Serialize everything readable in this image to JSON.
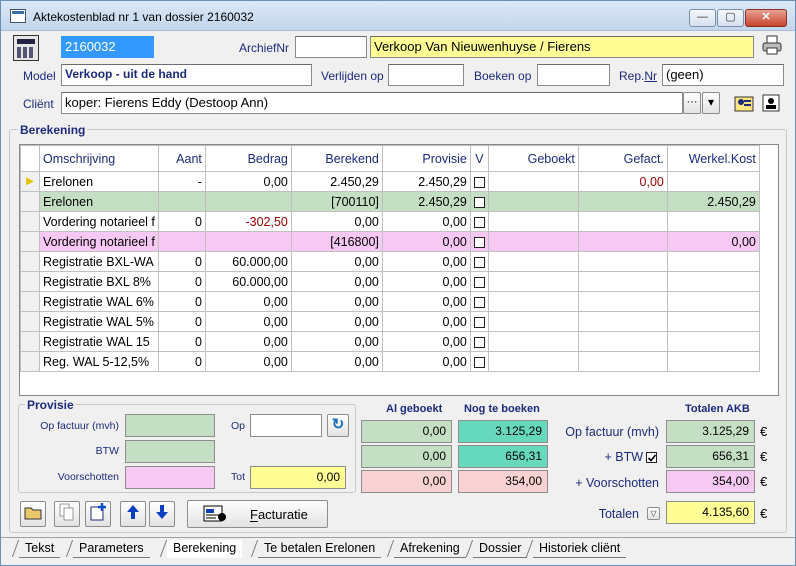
{
  "window": {
    "title": "Aktekostenblad nr 1 van dossier 2160032",
    "minimize": "—",
    "maximize": "▢",
    "close": "✕"
  },
  "header": {
    "dossier_no": "2160032",
    "archief_label": "ArchiefNr",
    "archief_value": "",
    "dossier_title": "Verkoop Van Nieuwenhuyse / Fierens",
    "model_label": "Model",
    "model_value": "Verkoop - uit de hand",
    "verlijden_label": "Verlijden op",
    "verlijden_value": "",
    "boeken_label": "Boeken op",
    "boeken_value": "",
    "repnr_label": "Rep.",
    "repnr_label_u": "Nr",
    "repnr_value": "(geen)",
    "client_label": "Cliënt",
    "client_value": "koper: Fierens Eddy (Destoop Ann)",
    "client_more": "···",
    "client_dropdown": "▾"
  },
  "berekening": {
    "title": "Berekening",
    "columns": [
      "Omschrijving",
      "Aant",
      "Bedrag",
      "Berekend",
      "Provisie",
      "V",
      "Geboekt",
      "Gefact.",
      "Werkel.Kost"
    ],
    "rows": [
      {
        "type": "normal",
        "current": "▶",
        "omschrijving": "Erelonen",
        "aant": "-",
        "bedrag": "0,00",
        "berekend": "2.450,29",
        "provisie": "2.450,29",
        "geboekt": "",
        "gefact": "0,00",
        "werkel": ""
      },
      {
        "type": "green",
        "current": "",
        "omschrijving": "Erelonen",
        "aant": "",
        "bedrag": "",
        "berekend": "[700110]",
        "provisie": "2.450,29",
        "geboekt": "",
        "gefact": "",
        "werkel": "2.450,29"
      },
      {
        "type": "normal",
        "current": "",
        "omschrijving": "Vordering notarieel f",
        "aant": "0",
        "bedrag": "-302,50",
        "berekend": "0,00",
        "provisie": "0,00",
        "geboekt": "",
        "gefact": "",
        "werkel": ""
      },
      {
        "type": "pink",
        "current": "",
        "omschrijving": "Vordering notarieel f",
        "aant": "",
        "bedrag": "",
        "berekend": "[416800]",
        "provisie": "0,00",
        "geboekt": "",
        "gefact": "",
        "werkel": "0,00"
      },
      {
        "type": "normal",
        "current": "",
        "omschrijving": "Registratie BXL-WA",
        "aant": "0",
        "bedrag": "60.000,00",
        "berekend": "0,00",
        "provisie": "0,00",
        "geboekt": "",
        "gefact": "",
        "werkel": ""
      },
      {
        "type": "normal",
        "current": "",
        "omschrijving": "Registratie BXL 8%",
        "aant": "0",
        "bedrag": "60.000,00",
        "berekend": "0,00",
        "provisie": "0,00",
        "geboekt": "",
        "gefact": "",
        "werkel": ""
      },
      {
        "type": "normal",
        "current": "",
        "omschrijving": "Registratie WAL 6%",
        "aant": "0",
        "bedrag": "0,00",
        "berekend": "0,00",
        "provisie": "0,00",
        "geboekt": "",
        "gefact": "",
        "werkel": ""
      },
      {
        "type": "normal",
        "current": "",
        "omschrijving": "Registratie WAL 5%",
        "aant": "0",
        "bedrag": "0,00",
        "berekend": "0,00",
        "provisie": "0,00",
        "geboekt": "",
        "gefact": "",
        "werkel": ""
      },
      {
        "type": "normal",
        "current": "",
        "omschrijving": "Registratie WAL 15",
        "aant": "0",
        "bedrag": "0,00",
        "berekend": "0,00",
        "provisie": "0,00",
        "geboekt": "",
        "gefact": "",
        "werkel": ""
      },
      {
        "type": "normal",
        "current": "",
        "omschrijving": "Reg. WAL 5-12,5%",
        "aant": "0",
        "bedrag": "0,00",
        "berekend": "0,00",
        "provisie": "0,00",
        "geboekt": "",
        "gefact": "",
        "werkel": ""
      }
    ]
  },
  "provisie": {
    "title": "Provisie",
    "op_factuur_label": "Op factuur (mvh)",
    "btw_label": "BTW",
    "voorschotten_label": "Voorschotten",
    "op_label": "Op",
    "op_value": "",
    "tot_label": "Tot",
    "tot_value": "0,00",
    "refresh": "↻"
  },
  "summary": {
    "al_geboekt_header": "Al geboekt",
    "nog_te_boeken_header": "Nog te boeken",
    "totalen_akb_header": "Totalen AKB",
    "al_geboekt": [
      "0,00",
      "0,00",
      "0,00"
    ],
    "nog_te_boeken": [
      "3.125,29",
      "656,31",
      "354,00"
    ],
    "op_factuur_label": "Op factuur (mvh)",
    "btw_label": "+ BTW",
    "voorschotten_label": "+ Voorschotten",
    "totalen_label": "Totalen",
    "akb_op_factuur": "3.125,29",
    "akb_btw": "656,31",
    "akb_voorschotten": "354,00",
    "akb_totalen": "4.135,60",
    "euro": "€"
  },
  "toolbar": {
    "facturatie_label": "Facturatie",
    "facturatie_underline": "F"
  },
  "tabs": [
    "Tekst",
    "Parameters",
    "Berekening",
    "Te betalen Erelonen",
    "Afrekening",
    "Dossier",
    "Historiek cliënt"
  ],
  "active_tab": "Berekening"
}
